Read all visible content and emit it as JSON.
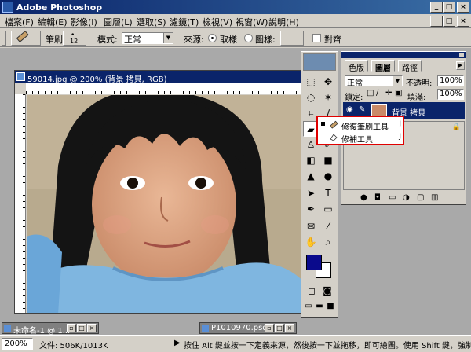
{
  "window": {
    "title": "Adobe Photoshop"
  },
  "menu": [
    "檔案(F)",
    "編輯(E)",
    "影像(I)",
    "圖層(L)",
    "選取(S)",
    "濾鏡(T)",
    "檢視(V)",
    "視窗(W)",
    "說明(H)"
  ],
  "options": {
    "brush_label": "筆刷:",
    "brush_size": "12",
    "mode_label": "模式:",
    "mode_value": "正常",
    "source_label": "來源:",
    "sampled_label": "取樣",
    "pattern_label": "圖樣:",
    "aligned_label": "對齊"
  },
  "document": {
    "title": "59014.jpg @ 200% (背景 拷貝, RGB)"
  },
  "layers_panel": {
    "tabs": [
      "色版",
      "圖層",
      "路徑"
    ],
    "blend_mode": "正常",
    "opacity_label": "不透明:",
    "opacity_value": "100%",
    "lock_label": "鎖定:",
    "fill_label": "填滿:",
    "fill_value": "100%",
    "layer_name": "背景 拷貝"
  },
  "flyout": {
    "items": [
      {
        "label": "修復筆刷工具",
        "key": "J",
        "selected": true
      },
      {
        "label": "修補工具",
        "key": "J",
        "selected": false
      }
    ]
  },
  "minimized": [
    {
      "title": "未命名-1 @ 1..."
    },
    {
      "title": "P1010970.psd"
    }
  ],
  "status": {
    "zoom": "200%",
    "doc_info": "文件: 506K/1013K",
    "hint": "按住 Alt 鍵並按一下定義來源，然後按一下並拖移，即可繪圖。使用 Shift 鍵，強制筆"
  },
  "colors": {
    "foreground": "#0a0a8c",
    "background": "#ffffff",
    "highlight": "#e00000",
    "title_bar": "#0a246a"
  }
}
